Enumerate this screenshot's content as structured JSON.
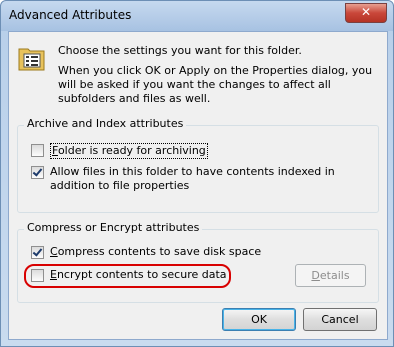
{
  "window": {
    "title": "Advanced Attributes",
    "close_label": "✕"
  },
  "intro": {
    "line1": "Choose the settings you want for this folder.",
    "line2": "When you click OK or Apply on the Properties dialog, you will be asked if you want the changes to affect all subfolders and files as well."
  },
  "archive_index": {
    "legend": "Archive and Index attributes",
    "folder_archiving": {
      "prefix": "",
      "mnemonic": "F",
      "rest": "older is ready for archiving",
      "checked": false
    },
    "allow_index": {
      "label": "Allow files in this folder to have contents indexed in addition to file properties",
      "checked": true
    }
  },
  "compress_encrypt": {
    "legend": "Compress or Encrypt attributes",
    "compress": {
      "mnemonic": "C",
      "rest": "ompress contents to save disk space",
      "checked": true
    },
    "encrypt": {
      "mnemonic": "E",
      "rest": "ncrypt contents to secure data",
      "checked": false
    },
    "details_button": {
      "mnemonic": "D",
      "rest": "etails"
    }
  },
  "buttons": {
    "ok": "OK",
    "cancel": "Cancel"
  },
  "colors": {
    "highlight": "#d80000",
    "title_bar": "#a7c2e2"
  }
}
